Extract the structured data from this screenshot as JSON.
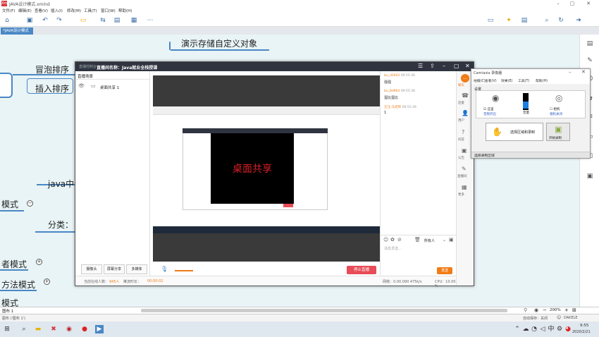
{
  "window": {
    "title": "JAVA设计模式.xmind",
    "logo": "Xm"
  },
  "menu": [
    "文件(F)",
    "编辑(E)",
    "查看(V)",
    "插入(I)",
    "修改(M)",
    "工具(T)",
    "窗口(W)",
    "帮助(H)"
  ],
  "tab": {
    "label": "*JAVA设计模式 ✕"
  },
  "mindmap": {
    "topic_top": "演示存储自定义对象",
    "bubble": "冒泡排序",
    "insert": "插入排序",
    "java": "java中",
    "mode": "模式",
    "cat": "分类：",
    "n1": "者模式",
    "n2": "方法模式",
    "n3": "模式"
  },
  "live": {
    "head_left": "直播控制台",
    "head_title": "直播间名称：Java就业全栈授课",
    "scenes_header": "直播场景",
    "scene_item": "桌面共享 1",
    "share_text": "桌面共享",
    "btn_camera": "摄像头",
    "btn_screen": "屏幕分享",
    "btn_multi": "多媒体",
    "btn_stop": "停止直播",
    "foot_online_label": "当前在线人数：",
    "foot_online": "945人",
    "foot_time_label": "推流时长：",
    "foot_time": "00:00:02",
    "foot_net": "网络：0.00.090  475k/s",
    "foot_cpu": "CPU：10.00 %",
    "chat": [
      {
        "user": "bu_d2943",
        "time": "09:55:36",
        "msg": "强强"
      },
      {
        "user": "bu_8d964",
        "time": "09:55:38",
        "msg": "蛋比蛋比"
      },
      {
        "user": "汪汪-马老师",
        "time": "09:55:39",
        "msg": "1"
      }
    ],
    "chat_target": "所有人",
    "chat_placeholder": "消息发送...",
    "send": "发送",
    "side_items": [
      "聊天",
      "连麦",
      "用户",
      "问答",
      "公告",
      "直播间",
      "更多"
    ]
  },
  "recorder": {
    "title": "Camtasia 录像器",
    "menu": [
      "拍摄(C)",
      "查看(V)",
      "效果(E)",
      "工具(T)",
      "帮助(H)"
    ],
    "section": "设置",
    "audio_label": "这里",
    "audio_sub": "音频开启",
    "volume": "音量",
    "camera_label": "相机",
    "camera_sub": "相机关闭",
    "select_region": "选择区域和录制",
    "record_btn": "开始录制",
    "status": "选择录制区域"
  },
  "status": {
    "page": "图布 1",
    "left": "图布 ('图布 1')",
    "zoom": "200%",
    "autosave": "自动保存：关闭",
    "user": "DAKELE"
  },
  "clock": {
    "time": "9:55",
    "date": "2020/2/21"
  },
  "colors": {
    "accent": "#4a87c5",
    "stop": "#e74c57",
    "orange": "#f07c16"
  }
}
